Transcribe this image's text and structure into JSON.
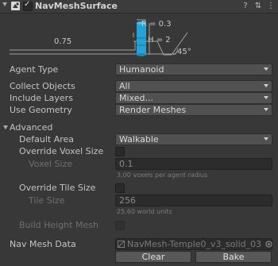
{
  "header": {
    "title": "NavMeshSurface",
    "enabled": true,
    "icons": [
      "help-icon",
      "settings-sliders-icon",
      "more-icon"
    ]
  },
  "diagram": {
    "radius_label": "R = 0.3",
    "height_label": "H = 2",
    "step_label": "0.75",
    "slope_label": "45°",
    "agent_color": "#24a3d6"
  },
  "fields": {
    "agent_type": {
      "label": "Agent Type",
      "value": "Humanoid"
    },
    "collect_objects": {
      "label": "Collect Objects",
      "value": "All"
    },
    "include_layers": {
      "label": "Include Layers",
      "value": "Mixed..."
    },
    "use_geometry": {
      "label": "Use Geometry",
      "value": "Render Meshes"
    }
  },
  "advanced": {
    "label": "Advanced",
    "default_area": {
      "label": "Default Area",
      "value": "Walkable"
    },
    "override_voxel": {
      "label": "Override Voxel Size",
      "checked": false
    },
    "voxel_size": {
      "label": "Voxel Size",
      "value": "0.1",
      "hint": "3,00 voxels per agent radius"
    },
    "override_tile": {
      "label": "Override Tile Size",
      "checked": false
    },
    "tile_size": {
      "label": "Tile Size",
      "value": "256",
      "hint": "25,60 world units"
    },
    "build_height_mesh": {
      "label": "Build Height Mesh",
      "checked": false
    }
  },
  "navmesh": {
    "label": "Nav Mesh Data",
    "value": "NavMesh-Temple0_v3_solid_03",
    "clear_label": "Clear",
    "bake_label": "Bake"
  }
}
